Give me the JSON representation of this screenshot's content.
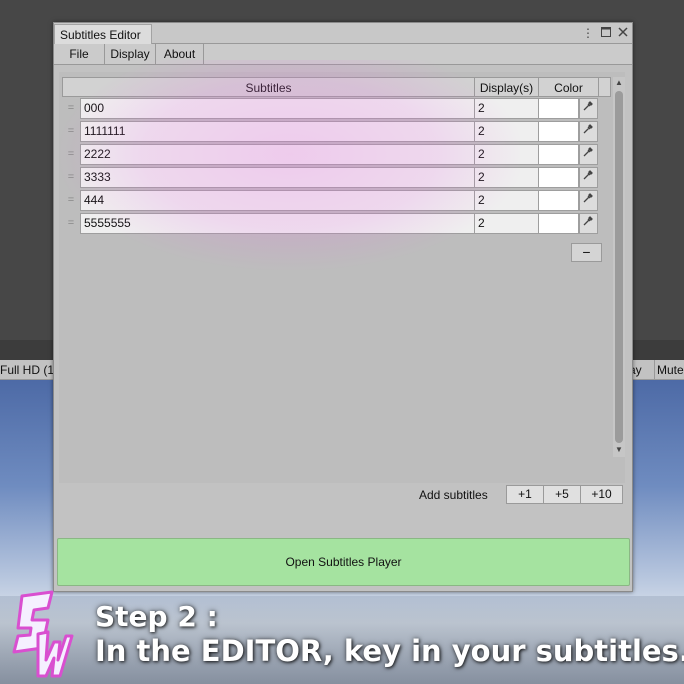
{
  "background": {
    "toolbar_left": "Full HD (1",
    "toolbar_right_1": "ay",
    "toolbar_right_2": "Mute"
  },
  "window": {
    "title": "Subtitles Editor",
    "controls": {
      "menu_icon": "kebab-icon",
      "maximize_icon": "maximize-icon",
      "close_icon": "close-icon"
    }
  },
  "menu": [
    "File",
    "Display",
    "About"
  ],
  "table": {
    "headers": {
      "subtitles": "Subtitles",
      "display": "Display(s)",
      "color": "Color"
    },
    "rows": [
      {
        "text": "000",
        "display": "2",
        "color": "#ffffff"
      },
      {
        "text": "1111111",
        "display": "2",
        "color": "#ffffff"
      },
      {
        "text": "2222",
        "display": "2",
        "color": "#ffffff"
      },
      {
        "text": "3333",
        "display": "2",
        "color": "#ffffff"
      },
      {
        "text": "444",
        "display": "2",
        "color": "#ffffff"
      },
      {
        "text": "5555555",
        "display": "2",
        "color": "#ffffff"
      }
    ],
    "remove_label": "−"
  },
  "add": {
    "label": "Add subtitles",
    "buttons": [
      "+1",
      "+5",
      "+10"
    ]
  },
  "open_player_label": "Open Subtitles Player",
  "caption": {
    "line1": "Step 2 :",
    "line2": "In the EDITOR, key in your subtitles."
  },
  "colors": {
    "open_button": "#a5e3a0",
    "highlight": "#eb6ee6",
    "logo_outline": "#d94fd0"
  }
}
